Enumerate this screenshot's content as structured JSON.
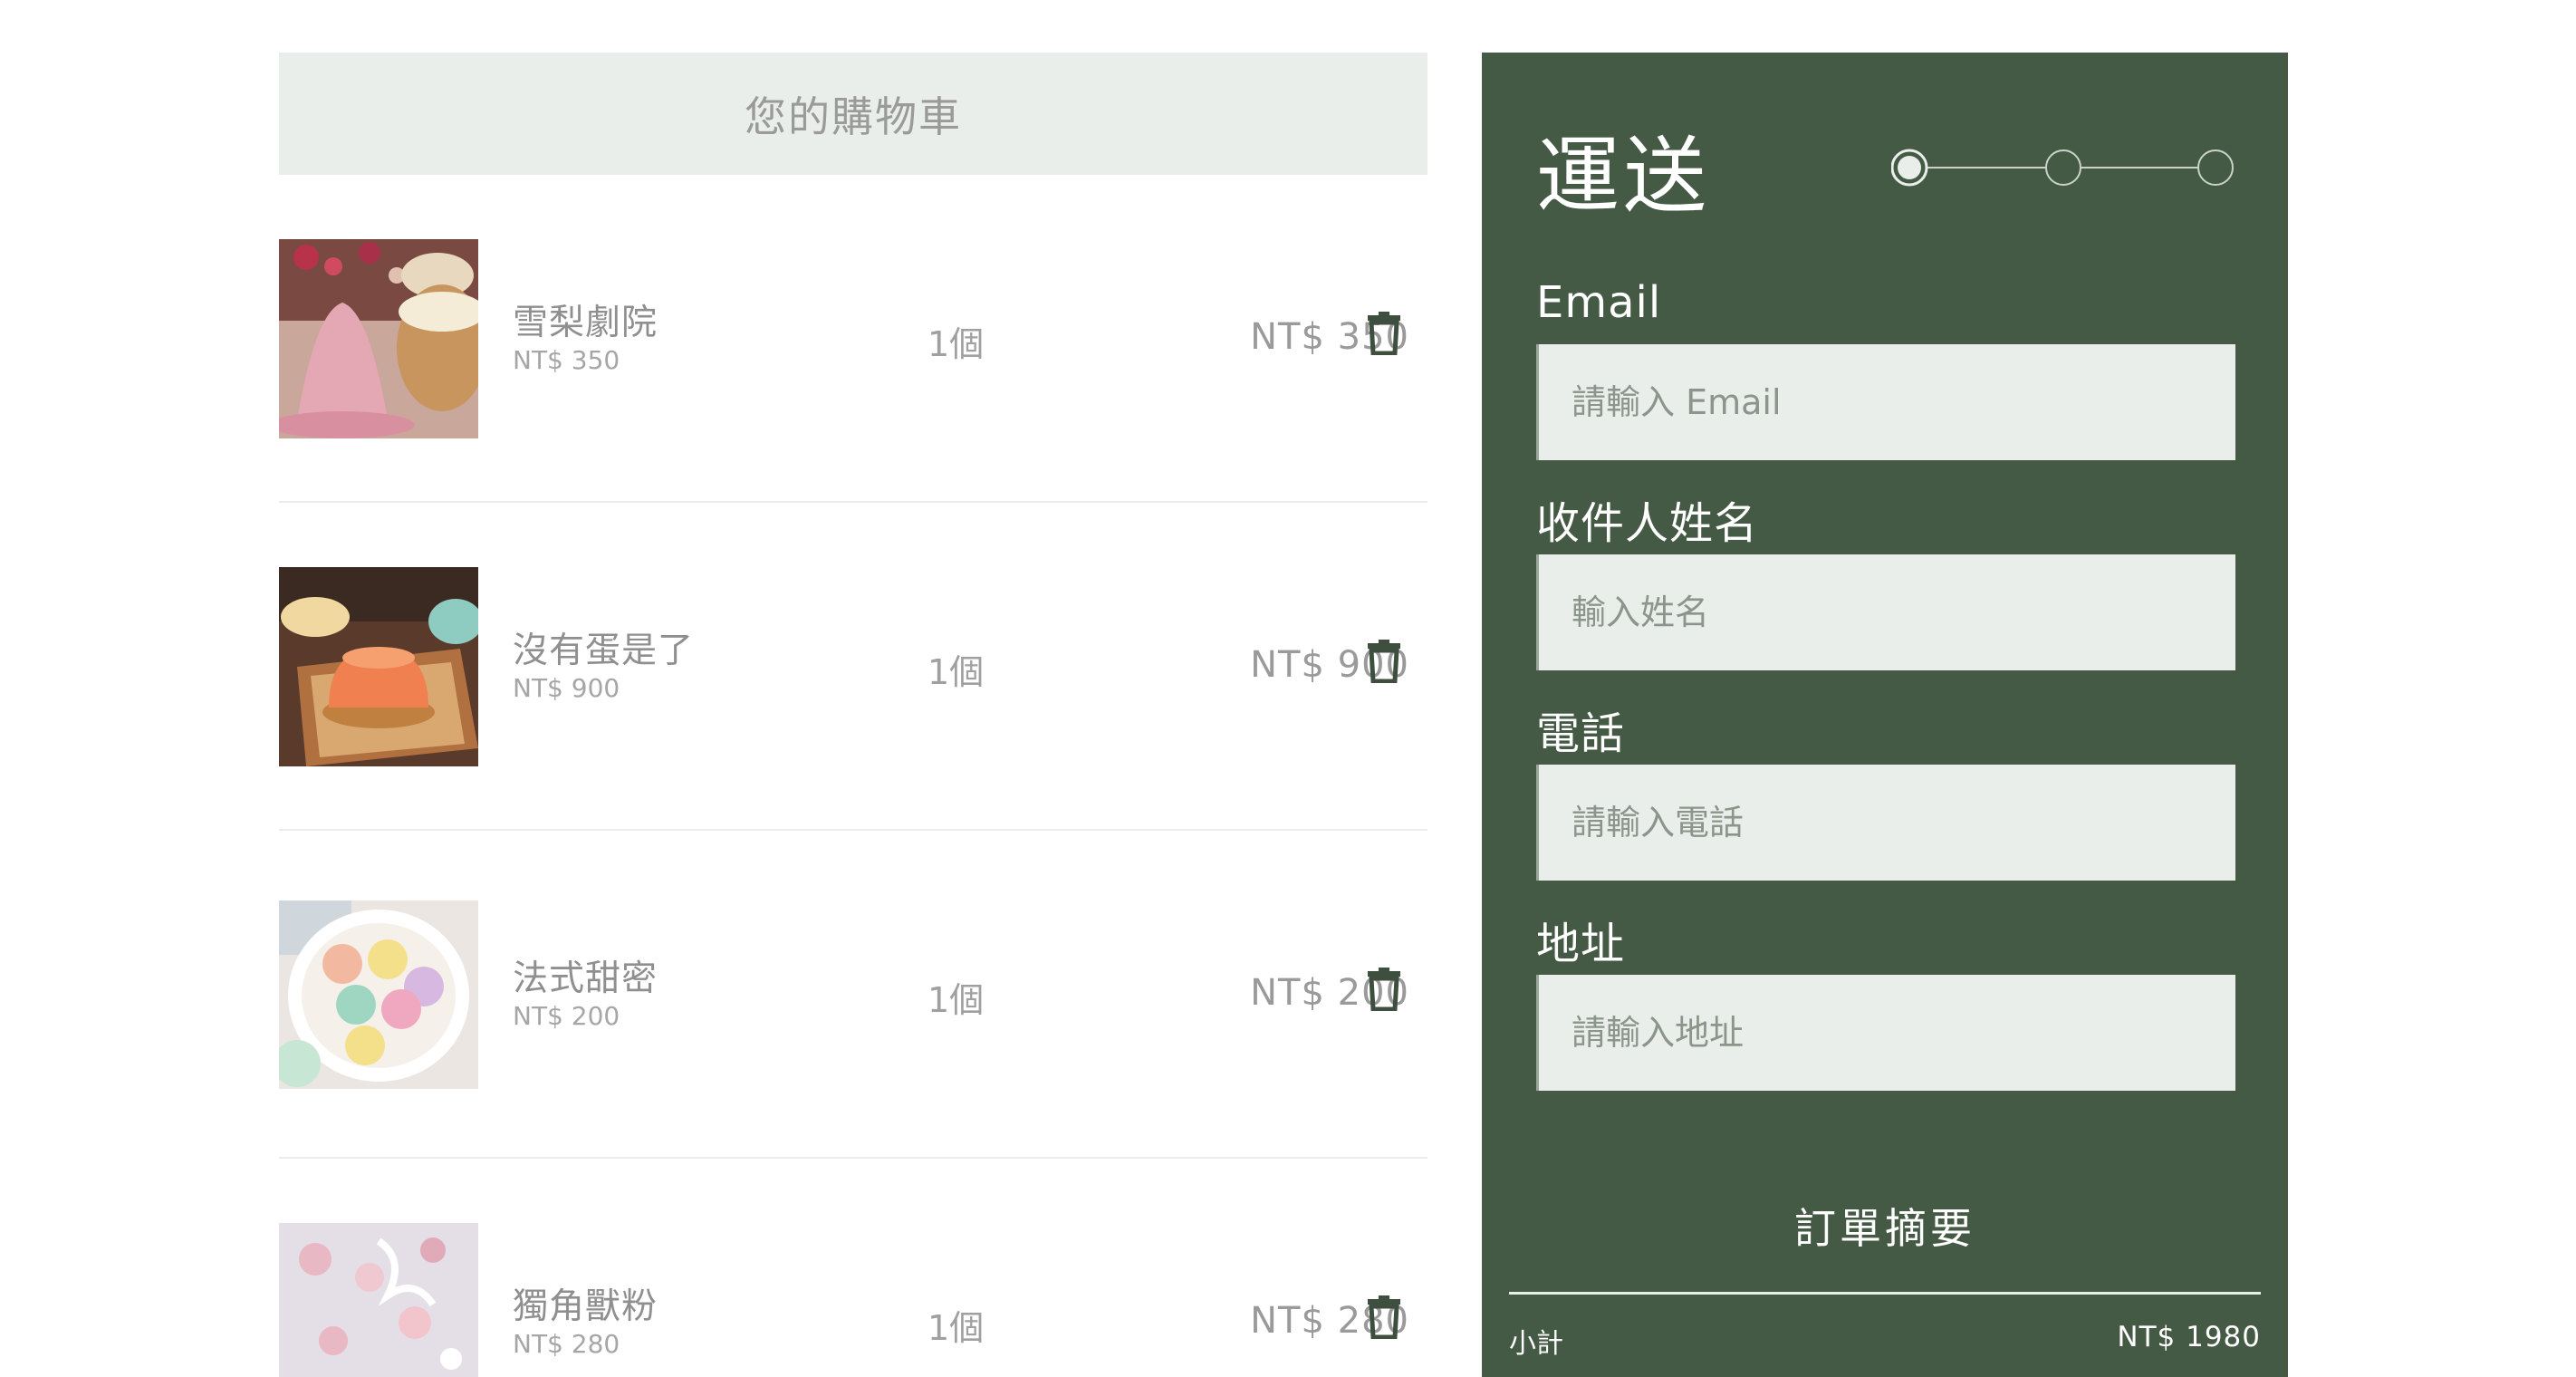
{
  "cart": {
    "title": "您的購物車",
    "items": [
      {
        "name": "雪梨劇院",
        "unit_price": "NT$ 350",
        "qty": "1個",
        "total": "NT$ 350",
        "thumb": "pink-dessert-photo"
      },
      {
        "name": "沒有蛋是了",
        "unit_price": "NT$ 900",
        "qty": "1個",
        "total": "NT$ 900",
        "thumb": "orange-mousse-photo"
      },
      {
        "name": "法式甜密",
        "unit_price": "NT$ 200",
        "qty": "1個",
        "total": "NT$ 200",
        "thumb": "macaron-plate-photo"
      },
      {
        "name": "獨角獸粉",
        "unit_price": "NT$ 280",
        "qty": "1個",
        "total": "NT$ 280",
        "thumb": "pink-macaron-photo"
      }
    ]
  },
  "shipping": {
    "title": "運送",
    "steps": {
      "count": 3,
      "current": 1
    },
    "fields": [
      {
        "label": "Email",
        "placeholder": "請輸入 Email"
      },
      {
        "label": "收件人姓名",
        "placeholder": "輸入姓名"
      },
      {
        "label": "電話",
        "placeholder": "請輸入電話"
      },
      {
        "label": "地址",
        "placeholder": "請輸入地址"
      }
    ]
  },
  "summary": {
    "title": "訂單摘要",
    "subtotal_label": "小計",
    "subtotal_value": "NT$ 1980"
  },
  "colors": {
    "panel_green": "#455a45",
    "input_bg": "#e9eeea",
    "header_bg": "#e9eeea",
    "trash_icon": "#3f4f3f"
  }
}
